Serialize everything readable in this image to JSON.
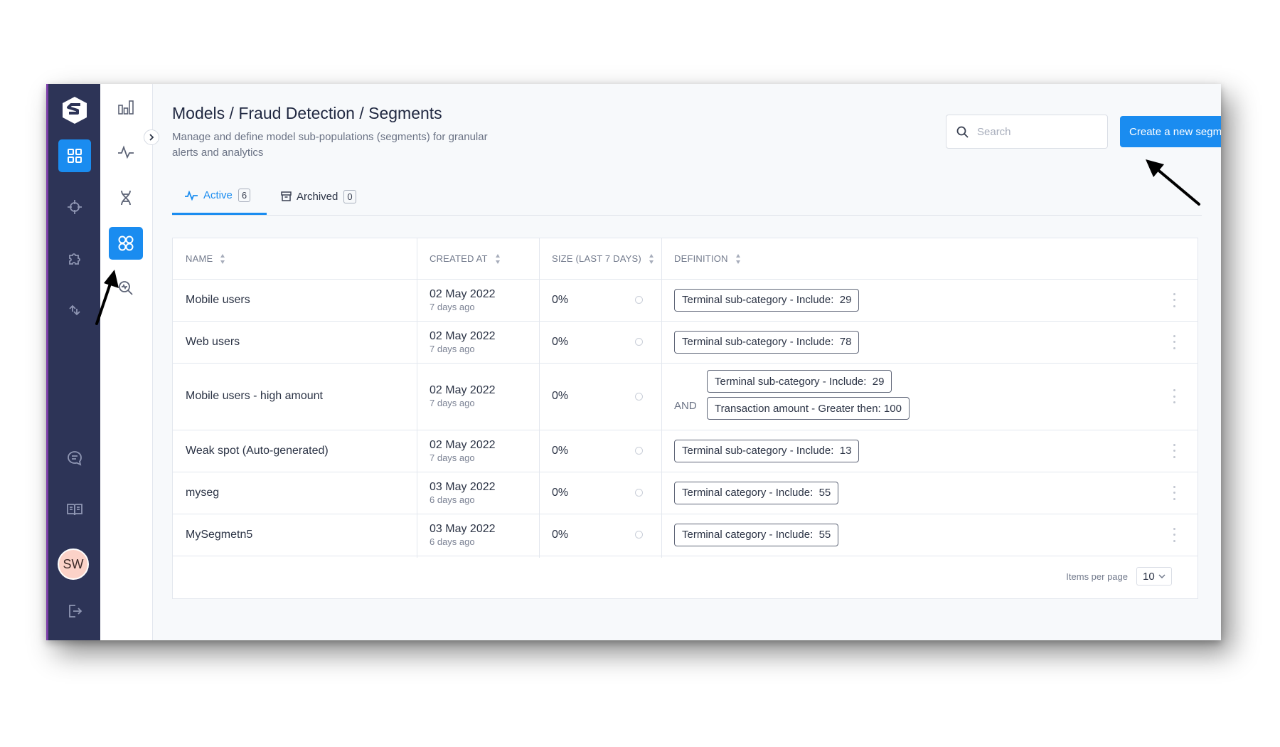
{
  "header": {
    "title": "Models / Fraud Detection / Segments",
    "description": "Manage and define model sub-populations (segments) for granular alerts and analytics"
  },
  "search": {
    "placeholder": "Search"
  },
  "actions": {
    "create_label": "Create a new segment"
  },
  "tabs": [
    {
      "label": "Active",
      "count": "6",
      "icon": "activity-icon",
      "active": true
    },
    {
      "label": "Archived",
      "count": "0",
      "icon": "archive-icon",
      "active": false
    }
  ],
  "table": {
    "columns": [
      "NAME",
      "CREATED AT",
      "SIZE (LAST 7 DAYS)",
      "DEFINITION"
    ],
    "rows": [
      {
        "name": "Mobile users",
        "created": "02 May 2022",
        "ago": "7 days ago",
        "size": "0%",
        "conditions": [
          "Terminal sub-category - Include:  29"
        ]
      },
      {
        "name": "Web users",
        "created": "02 May 2022",
        "ago": "7 days ago",
        "size": "0%",
        "conditions": [
          "Terminal sub-category - Include:  78"
        ]
      },
      {
        "name": "Mobile users - high amount",
        "created": "02 May 2022",
        "ago": "7 days ago",
        "size": "0%",
        "connector": "AND",
        "conditions": [
          "Terminal sub-category - Include:  29",
          "Transaction amount - Greater then: 100"
        ]
      },
      {
        "name": "Weak spot (Auto-generated)",
        "created": "02 May 2022",
        "ago": "7 days ago",
        "size": "0%",
        "conditions": [
          "Terminal sub-category - Include:  13"
        ]
      },
      {
        "name": "myseg",
        "created": "03 May 2022",
        "ago": "6 days ago",
        "size": "0%",
        "conditions": [
          "Terminal category - Include:  55"
        ]
      },
      {
        "name": "MySegmetn5",
        "created": "03 May 2022",
        "ago": "6 days ago",
        "size": "0%",
        "conditions": [
          "Terminal category - Include:  55"
        ]
      }
    ]
  },
  "pagination": {
    "label": "Items per page",
    "value": "10"
  },
  "user": {
    "initials": "SW"
  },
  "colors": {
    "accent": "#1a8cf0",
    "rail": "#2d3457"
  }
}
